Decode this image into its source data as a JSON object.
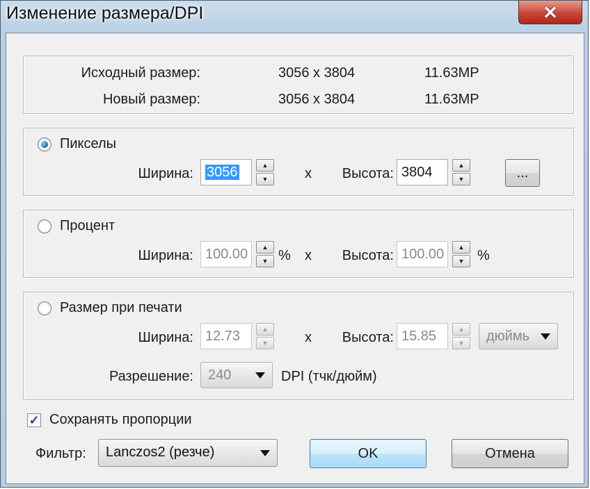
{
  "window": {
    "title": "Изменение размера/DPI",
    "close_glyph": "✕"
  },
  "info": {
    "original_label": "Исходный размер:",
    "original_dims": "3056 x 3804",
    "original_mp": "11.63MP",
    "new_label": "Новый размер:",
    "new_dims": "3056 x 3804",
    "new_mp": "11.63MP"
  },
  "pixels": {
    "radio_label": "Пикселы",
    "selected": true,
    "width_label": "Ширина:",
    "width_value": "3056",
    "x_sep": "x",
    "height_label": "Высота:",
    "height_value": "3804",
    "more_button": "..."
  },
  "percent": {
    "radio_label": "Процент",
    "selected": false,
    "width_label": "Ширина:",
    "width_value": "100.00",
    "width_unit": "%",
    "x_sep": "x",
    "height_label": "Высота:",
    "height_value": "100.00",
    "height_unit": "%"
  },
  "print": {
    "radio_label": "Размер при печати",
    "selected": false,
    "width_label": "Ширина:",
    "width_value": "12.73",
    "x_sep": "x",
    "height_label": "Высота:",
    "height_value": "15.85",
    "unit_select": "дюймь",
    "resolution_label": "Разрешение:",
    "resolution_value": "240",
    "resolution_unit": "DPI (тчк/дюйм)"
  },
  "keep_ratio": {
    "label": "Сохранять пропорции",
    "checked": true,
    "check_glyph": "✓"
  },
  "filter": {
    "label": "Фильтр:",
    "value": "Lanczos2 (резче)"
  },
  "buttons": {
    "ok": "OK",
    "cancel": "Отмена"
  },
  "icons": {
    "spin_up": "▲",
    "spin_down": "▼"
  }
}
